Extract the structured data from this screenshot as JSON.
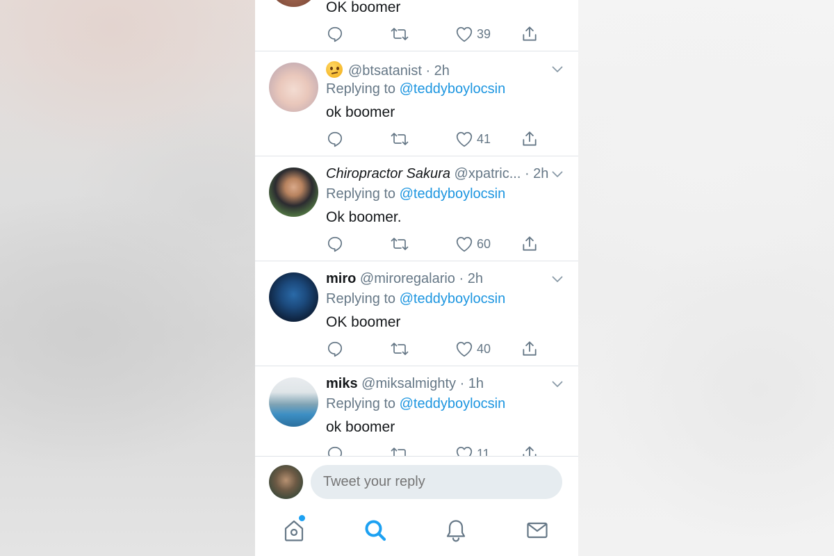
{
  "tweets": [
    {
      "display_name": "",
      "handle_time": "",
      "replying_prefix": "",
      "mention": "",
      "text": "OK boomer",
      "likes": "39"
    },
    {
      "display_name": "",
      "handle_time": "@btsatanist · 2h",
      "replying_prefix": "Replying to ",
      "mention": "@teddyboylocsin",
      "text": "ok boomer",
      "likes": "41"
    },
    {
      "display_name": "Chiropractor Sakura",
      "handle_time": "@xpatric... · 2h",
      "replying_prefix": "Replying to ",
      "mention": "@teddyboylocsin",
      "text": "Ok boomer.",
      "likes": "60"
    },
    {
      "display_name": "miro",
      "handle_time": "@miroregalario · 2h",
      "replying_prefix": "Replying to ",
      "mention": "@teddyboylocsin",
      "text": "OK boomer",
      "likes": "40"
    },
    {
      "display_name": "miks",
      "handle_time": "@miksalmighty · 1h",
      "replying_prefix": "Replying to ",
      "mention": "@teddyboylocsin",
      "text": "ok boomer",
      "likes": "11"
    }
  ],
  "compose": {
    "placeholder": "Tweet your reply"
  },
  "tabs": [
    {
      "icon": "home-icon",
      "has_notification_dot": true
    },
    {
      "icon": "search-icon",
      "active": true
    },
    {
      "icon": "bell-icon"
    },
    {
      "icon": "mail-icon"
    }
  ],
  "colors": {
    "accent": "#1da1f2",
    "mention": "#1b95e0",
    "secondary_text": "#657786",
    "primary_text": "#14171a",
    "divider": "#dfe3e7",
    "reply_box_bg": "#e6ecf0"
  }
}
